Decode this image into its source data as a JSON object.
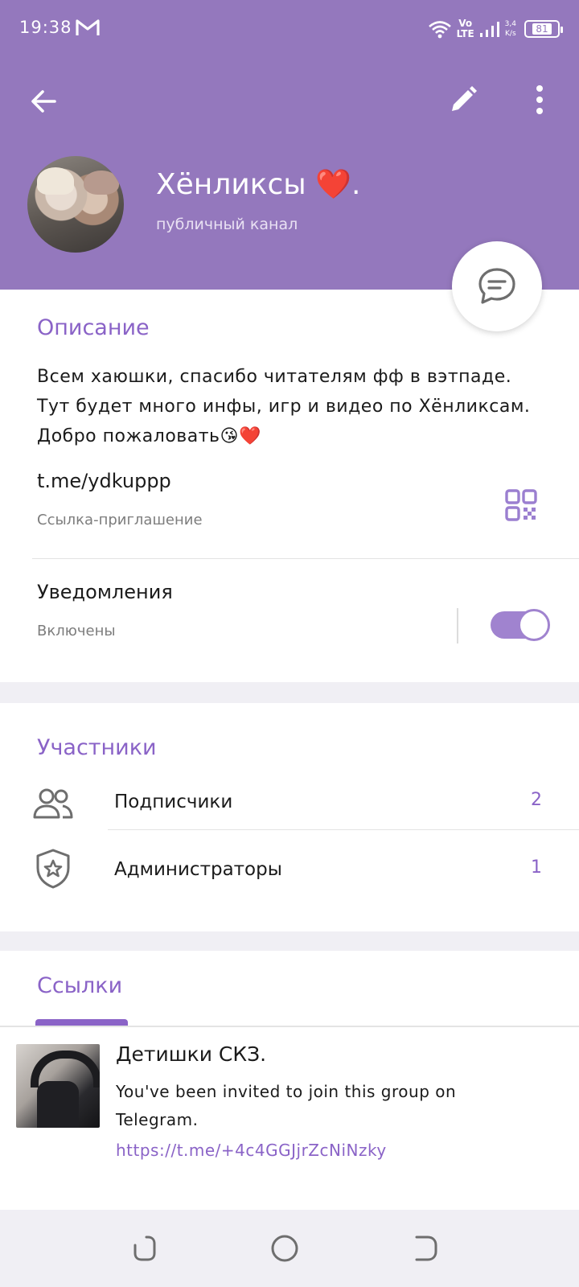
{
  "status_bar": {
    "time": "19:38",
    "network_top": "Vo",
    "network_bottom": "LTE",
    "speed_top": "3,4",
    "speed_bottom": "K/s",
    "battery": "81",
    "icons": [
      "gmail-icon",
      "wifi-icon",
      "signal-icon",
      "battery-icon"
    ]
  },
  "toolbar": {
    "icons": [
      "back-arrow-icon",
      "pencil-icon",
      "more-vertical-icon"
    ]
  },
  "profile": {
    "name": "Хёнликсы ❤️.",
    "type": "публичный канал"
  },
  "info": {
    "description_title": "Описание",
    "description": "Всем хаюшки, спасибо читателям фф в вэтпаде. Тут будет много инфы, игр и видео по Хёнликсам. Добро пожаловать😘❤️",
    "link": "t.me/ydkuppp",
    "link_caption": "Ссылка-приглашение",
    "notifications_label": "Уведомления",
    "notifications_status": "Включены",
    "notifications_enabled": true
  },
  "members": {
    "title": "Участники",
    "rows": [
      {
        "label": "Подписчики",
        "count": "2",
        "icon": "users-icon"
      },
      {
        "label": "Администраторы",
        "count": "1",
        "icon": "shield-star-icon"
      }
    ]
  },
  "links": {
    "title": "Ссылки",
    "items": [
      {
        "title": "Детишки СКЗ.",
        "description": "You've been invited to join this group on Telegram.",
        "url": "https://t.me/+4c4GGJjrZcNiNzky"
      }
    ]
  },
  "colors": {
    "header": "#9478bd",
    "accent": "#8a63c7",
    "toggle": "#a083cf"
  }
}
